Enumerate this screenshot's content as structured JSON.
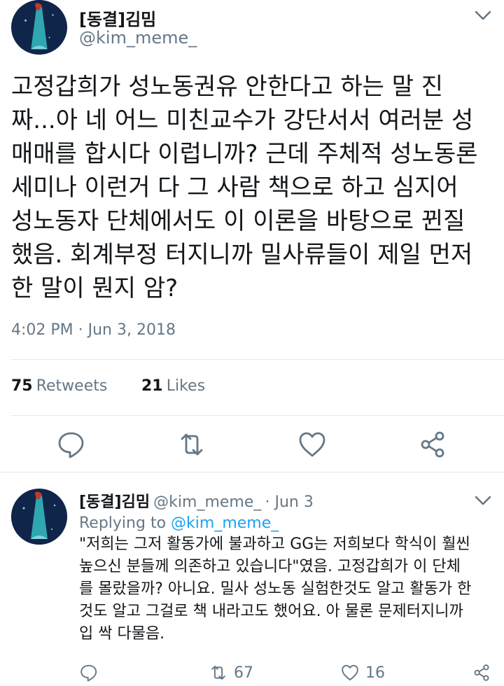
{
  "main_tweet": {
    "display_name": "[동결]김밈",
    "handle": "@kim_meme_",
    "text_lines": [
      "고정갑희가 성노동권유 안한다고 하는 말 진",
      "짜...아 네 어느 미친교수가 강단서서 여러분 성",
      "매매를 합시다 이럽니까? 근데 주체적 성노동론",
      "세미나 이런거 다 그 사람 책으로 하고 심지어",
      "성노동자 단체에서도 이 이론을 바탕으로 뀐질",
      "했음. 회계부정 터지니까 밀사류들이 제일 먼저",
      "한 말이 뭔지 암?"
    ],
    "timestamp": "4:02 PM · Jun 3, 2018",
    "retweets_count": "75",
    "retweets_label": "Retweets",
    "likes_count": "21",
    "likes_label": "Likes"
  },
  "reply": {
    "display_name": "[동결]김밈",
    "handle": "@kim_meme_",
    "date": "· Jun 3",
    "replying_prefix": "Replying to",
    "replying_handle": "@kim_meme_",
    "text_lines": [
      "\"저희는 그저 활동가에 불과하고 GG는 저희보다 학식이 훨씬",
      "높으신 분들께 의존하고 있습니다\"였음. 고정갑희가 이 단체",
      "를 몰랐을까? 아니요. 밀사 성노동 실험한것도 알고 활동가 한",
      "것도 알고 그걸로 책 내라고도 했어요. 아 물론 문제터지니까",
      "입 싹 다물음."
    ],
    "retweet_count": "67",
    "like_count": "16"
  },
  "icons": {
    "menu": "chevron-down-icon",
    "reply": "reply-icon",
    "retweet": "retweet-icon",
    "like": "heart-icon",
    "share": "share-icon"
  },
  "colors": {
    "text": "#14171a",
    "secondary": "#657786",
    "link": "#1da1f2",
    "divider": "#e1e8ed"
  }
}
